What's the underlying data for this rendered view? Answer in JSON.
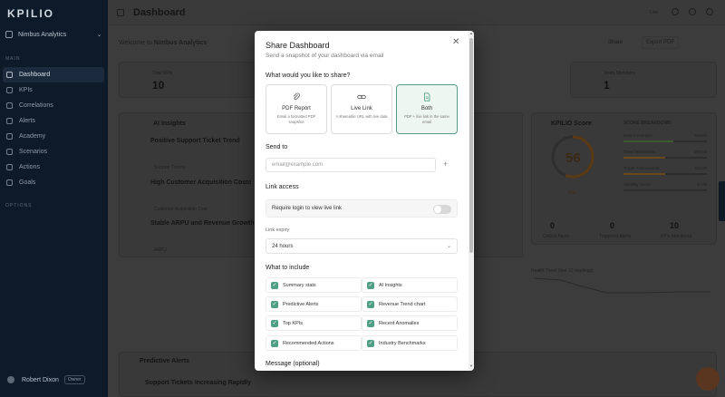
{
  "sidebar": {
    "brand": "KPILIO",
    "workspace": "Nimbus Analytics",
    "main_section": "MAIN",
    "other_section": "OPTIONS",
    "items": [
      {
        "label": "Dashboard",
        "active": true
      },
      {
        "label": "KPIs"
      },
      {
        "label": "Correlations"
      },
      {
        "label": "Alerts"
      },
      {
        "label": "Academy"
      },
      {
        "label": "Scenarios"
      },
      {
        "label": "Actions"
      },
      {
        "label": "Goals"
      }
    ],
    "user": {
      "name": "Robert Dixon",
      "role": "Owner"
    }
  },
  "topbar": {
    "title": "Dashboard",
    "live": "Live"
  },
  "main": {
    "welcome_prefix": "Welcome to",
    "welcome_org": "Nimbus Analytics",
    "share_label": "Share",
    "export_label": "Export PDF",
    "stat1": {
      "label": "Total KPIs",
      "value": "10"
    },
    "stat2": {
      "label": "Team Members",
      "value": "1"
    },
    "ai_title": "AI Insights",
    "insights": [
      {
        "title": "Positive Support Ticket Trend",
        "tag": "Support Tickets"
      },
      {
        "title": "High Customer Acquisition Costs",
        "tag": "Customer Acquisition Cost"
      },
      {
        "title": "Stable ARPU and Revenue Growth",
        "tag": "ARPU"
      }
    ],
    "score_title": "KPILIO Score",
    "score_value": "56",
    "score_grade": "Fair",
    "breakdown_title": "SCORE BREAKDOWN",
    "breakdown": [
      {
        "label": "Data Freshness",
        "value": "60/100",
        "pct": 60,
        "color": "#3b5c30"
      },
      {
        "label": "Trend Momentum",
        "value": "50/100",
        "pct": 50,
        "color": "#6a4a1a"
      },
      {
        "label": "Target Achievement",
        "value": "50/100",
        "pct": 50,
        "color": "#6a4a1a"
      },
      {
        "label": "Volatility Score",
        "value": "0/100",
        "pct": 0,
        "color": "#4a2020"
      }
    ],
    "mini_stats": [
      {
        "value": "0",
        "label": "Critical Alerts"
      },
      {
        "value": "0",
        "label": "Triggered Alerts"
      },
      {
        "value": "10",
        "label": "KPIs Monitored"
      }
    ],
    "health_title": "Health Trend (last 10 readings)",
    "predictive_title": "Predictive Alerts",
    "predictive_row": "Support Tickets Increasing Rapidly"
  },
  "modal": {
    "title": "Share Dashboard",
    "subtitle": "Send a snapshot of your dashboard via email",
    "share_question": "What would you like to share?",
    "options": [
      {
        "label": "PDF Report",
        "desc": "Email a formatted PDF snapshot",
        "icon": "paperclip-icon"
      },
      {
        "label": "Live Link",
        "desc": "A shareable URL with live data",
        "icon": "link-icon"
      },
      {
        "label": "Both",
        "desc": "PDF + live link in the same email",
        "icon": "document-icon",
        "selected": true
      }
    ],
    "send_to": "Send to",
    "email_placeholder": "email@example.com",
    "link_access": "Link access",
    "require_login": "Require login to view live link",
    "require_login_on": false,
    "link_expiry": "Link expiry",
    "expiry_value": "24 hours",
    "include_title": "What to include",
    "include": [
      {
        "label": "Summary stats",
        "checked": true
      },
      {
        "label": "AI Insights",
        "checked": true
      },
      {
        "label": "Predictive Alerts",
        "checked": true
      },
      {
        "label": "Revenue Trend chart",
        "checked": true
      },
      {
        "label": "Top KPIs",
        "checked": true
      },
      {
        "label": "Recent Anomalies",
        "checked": true
      },
      {
        "label": "Recommended Actions",
        "checked": true
      },
      {
        "label": "Industry Benchmarks",
        "checked": true
      }
    ],
    "message_label": "Message (optional)",
    "accent": "#4f9e86"
  }
}
